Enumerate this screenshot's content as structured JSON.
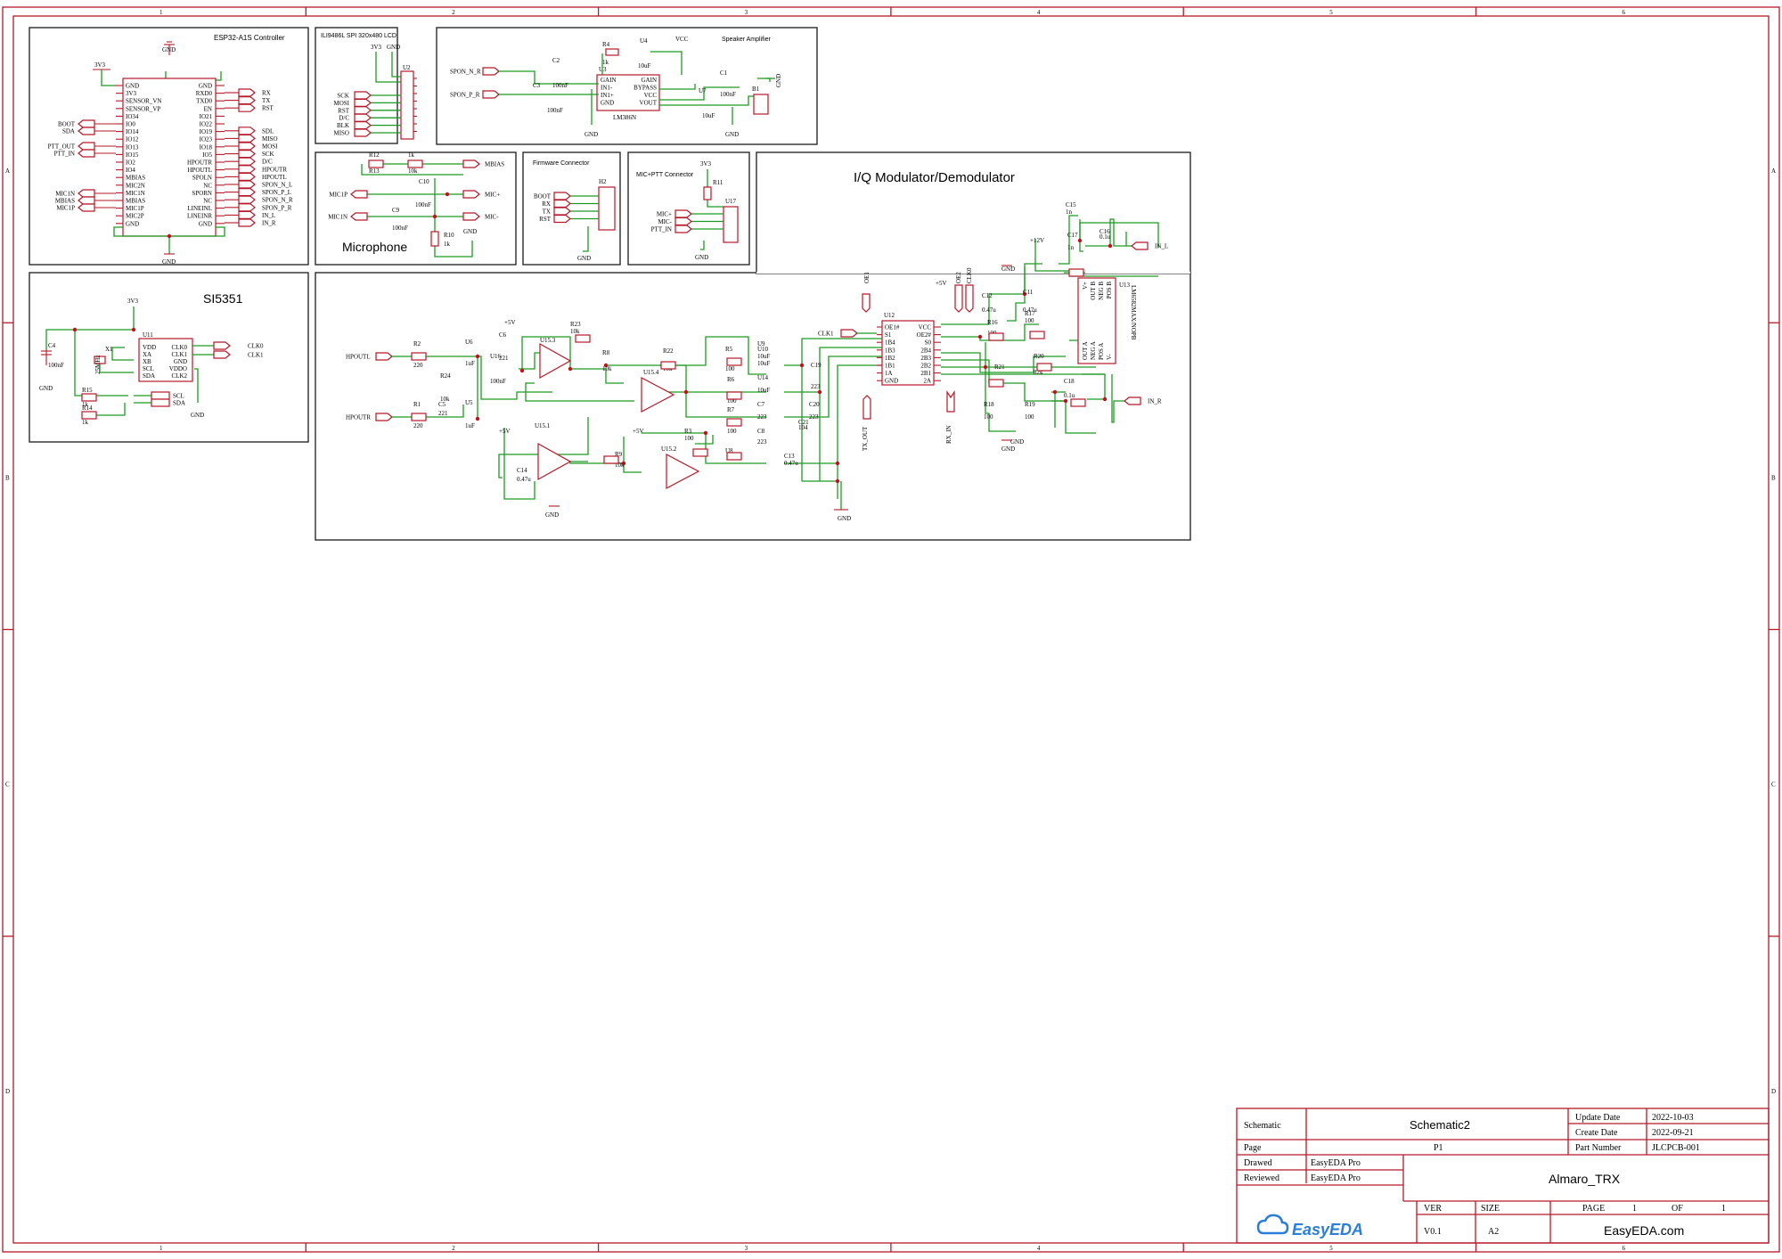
{
  "border": {
    "columns": [
      "1",
      "2",
      "3",
      "4",
      "5",
      "6"
    ],
    "rows": [
      "A",
      "B",
      "C",
      "D"
    ]
  },
  "blocks": {
    "esp32": {
      "title": "ESP32-A1S Controller",
      "left_pins": [
        "GND",
        "3V3",
        "SENSOR_VN",
        "SENSOR_VP",
        "IO34",
        "IO0",
        "IO14",
        "IO12",
        "IO13",
        "IO15",
        "IO2",
        "IO4",
        "MBIAS",
        "MIC2N",
        "MIC1N",
        "MBIAS",
        "MIC1P",
        "MIC2P",
        "GND"
      ],
      "right_pins": [
        "GND",
        "RXD0",
        "TXD0",
        "EN",
        "IO21",
        "IO22",
        "IO19",
        "IO23",
        "IO18",
        "IO5",
        "HPOUTR",
        "HPOUTL",
        "SPOLN",
        "NC",
        "SPORN",
        "NC",
        "LINEINL",
        "LINEINR",
        "GND"
      ],
      "left_nets": [
        "BOOT",
        "SDA",
        "PTT_OUT",
        "PTT_IN",
        "MIC1N",
        "MBIAS",
        "MIC1P"
      ],
      "right_nets": [
        "RX",
        "TX",
        "RST",
        "SDL",
        "MISO",
        "MOSI",
        "SCK",
        "D/C",
        "HPOUTR",
        "HPOUTL",
        "SPON_N_L",
        "SPON_P_L",
        "SPON_N_R",
        "SPON_P_R",
        "IN_L",
        "IN_R"
      ],
      "power": [
        "3V3",
        "GND",
        "GND"
      ]
    },
    "lcd": {
      "title": "ILI9486L SPI 320x480 LCD",
      "ref": "U2",
      "nets": [
        "SCK",
        "MOSI",
        "RST",
        "D/C",
        "BLK",
        "MISO"
      ],
      "power": [
        "3V3",
        "GND"
      ]
    },
    "speaker": {
      "title": "Speaker Amplifier",
      "inputs": [
        "SPON_N_R",
        "SPON_P_R"
      ],
      "ic_ref": "U3",
      "ic_name": "LM386N",
      "ic_pins_left": [
        "GAIN",
        "IN1-",
        "IN1+",
        "GND"
      ],
      "ic_pins_right": [
        "GAIN",
        "BYPASS",
        "VCC",
        "VOUT"
      ],
      "parts": [
        "R4",
        "1k",
        "U4",
        "10uF",
        "C2",
        "100nF",
        "C3",
        "100nF",
        "C1",
        "100nF",
        "U7",
        "10uF",
        "B1"
      ],
      "power": [
        "VCC",
        "GND",
        "GND",
        "GND"
      ]
    },
    "microphone": {
      "title": "Microphone",
      "parts": [
        "R12",
        "1k",
        "R13",
        "10k",
        "C10",
        "100nF",
        "C9",
        "100nF",
        "R10",
        "1k"
      ],
      "nets": [
        "MBIAS",
        "MIC1P",
        "MIC+",
        "MIC1N",
        "MIC-"
      ],
      "power": [
        "GND"
      ]
    },
    "firmware": {
      "title": "Firmware Connector",
      "ref": "H2",
      "nets": [
        "BOOT",
        "RX",
        "TX",
        "RST"
      ],
      "power": [
        "GND"
      ]
    },
    "ptt": {
      "title": "MIC+PTT Connector",
      "parts": [
        "R11",
        "U17"
      ],
      "nets": [
        "MIC+",
        "MIC-",
        "PTT_IN"
      ],
      "power": [
        "3V3",
        "GND"
      ]
    },
    "si5351": {
      "title": "SI5351",
      "ref": "U11",
      "pins_left": [
        "VDD",
        "XA",
        "XB",
        "SCL",
        "SDA"
      ],
      "pins_right": [
        "CLK0",
        "CLK1",
        "GND",
        "VDDO",
        "CLK2"
      ],
      "parts": [
        "C4",
        "100nF",
        "X1",
        "25MHz",
        "R15",
        "1k",
        "R14",
        "1k"
      ],
      "nets": [
        "CLK0",
        "CLK1",
        "SCL",
        "SDA"
      ],
      "power": [
        "3V3",
        "GND",
        "GND"
      ]
    },
    "iq": {
      "title": "I/Q Modulator/Demodulator",
      "inputs": [
        "HPOUTL",
        "HPOUTR"
      ],
      "mux_ref": "U12",
      "mux_pins_left": [
        "OE1#",
        "S1",
        "1B4",
        "1B3",
        "1B2",
        "1B1",
        "1A",
        "GND"
      ],
      "mux_pins_right": [
        "VCC",
        "OE2#",
        "S0",
        "2B4",
        "2B3",
        "2B2",
        "2B1",
        "2A"
      ],
      "opamp_ref": "U13",
      "opamp_name": "LM6582MAX/NOPB",
      "opamp_pins": [
        "V+",
        "OUT B",
        "NEG B",
        "POS B",
        "OUT A",
        "NEG A",
        "POS A",
        "V-"
      ],
      "amp_refs": [
        "U15.3",
        "U15.4",
        "U15.1",
        "U15.2"
      ],
      "parts": [
        "R2",
        "220",
        "R1",
        "220",
        "U6",
        "1uF",
        "U5",
        "1uF",
        "U16",
        "100nF",
        "C6",
        "221",
        "C5",
        "221",
        "R24",
        "10k",
        "R23",
        "10k",
        "R8",
        "10k",
        "R22",
        "10k",
        "R9",
        "10k",
        "R3",
        "100",
        "R5",
        "100",
        "R6",
        "100",
        "R7",
        "100",
        "U8",
        "10uF",
        "U9",
        "10uF",
        "U10",
        "10uF",
        "U14",
        "10uF",
        "C7",
        "223",
        "C8",
        "223",
        "C19",
        "223",
        "C20",
        "223",
        "C21",
        "104",
        "C13",
        "0.47u",
        "C14",
        "0.47u",
        "C12",
        "0.47u",
        "C11",
        "0.47u",
        "R18",
        "100",
        "R19",
        "100",
        "R16",
        "100",
        "R17",
        "100",
        "R21",
        "82k",
        "R20",
        "82k",
        "C17",
        "1n",
        "C18",
        "0.1u",
        "C15",
        "1n",
        "C16",
        "0.1u"
      ],
      "nets": [
        "CLK1",
        "TX_OUT",
        "RX_IN",
        "OE1",
        "OE2",
        "CLK0",
        "IN_L",
        "IN_R"
      ],
      "power": [
        "+5V",
        "+5V",
        "+5V",
        "+5V",
        "+12V",
        "GND",
        "GND",
        "GND",
        "GND",
        "GND"
      ]
    }
  },
  "title_block": {
    "schematic_label": "Schematic",
    "schematic_name": "Schematic2",
    "page_label": "Page",
    "page_name": "P1",
    "update_label": "Update Date",
    "update_value": "2022-10-03",
    "create_label": "Create Date",
    "create_value": "2022-09-21",
    "part_label": "Part Number",
    "part_value": "JLCPCB-001",
    "drawed_label": "Drawed",
    "drawed_value": "EasyEDA Pro",
    "reviewed_label": "Reviewed",
    "reviewed_value": "EasyEDA Pro",
    "project": "Almaro_TRX",
    "ver_label": "VER",
    "ver_value": "V0.1",
    "size_label": "SIZE",
    "size_value": "A2",
    "page_num_label": "PAGE",
    "page_num_value": "1",
    "of_label": "OF",
    "of_value": "1",
    "logo": "EasyEDA",
    "website": "EasyEDA.com"
  },
  "colors": {
    "frame": "#b5192a",
    "wire": "#1e9a24",
    "junction": "#c4101a",
    "block_border": "#2a2a2a"
  }
}
